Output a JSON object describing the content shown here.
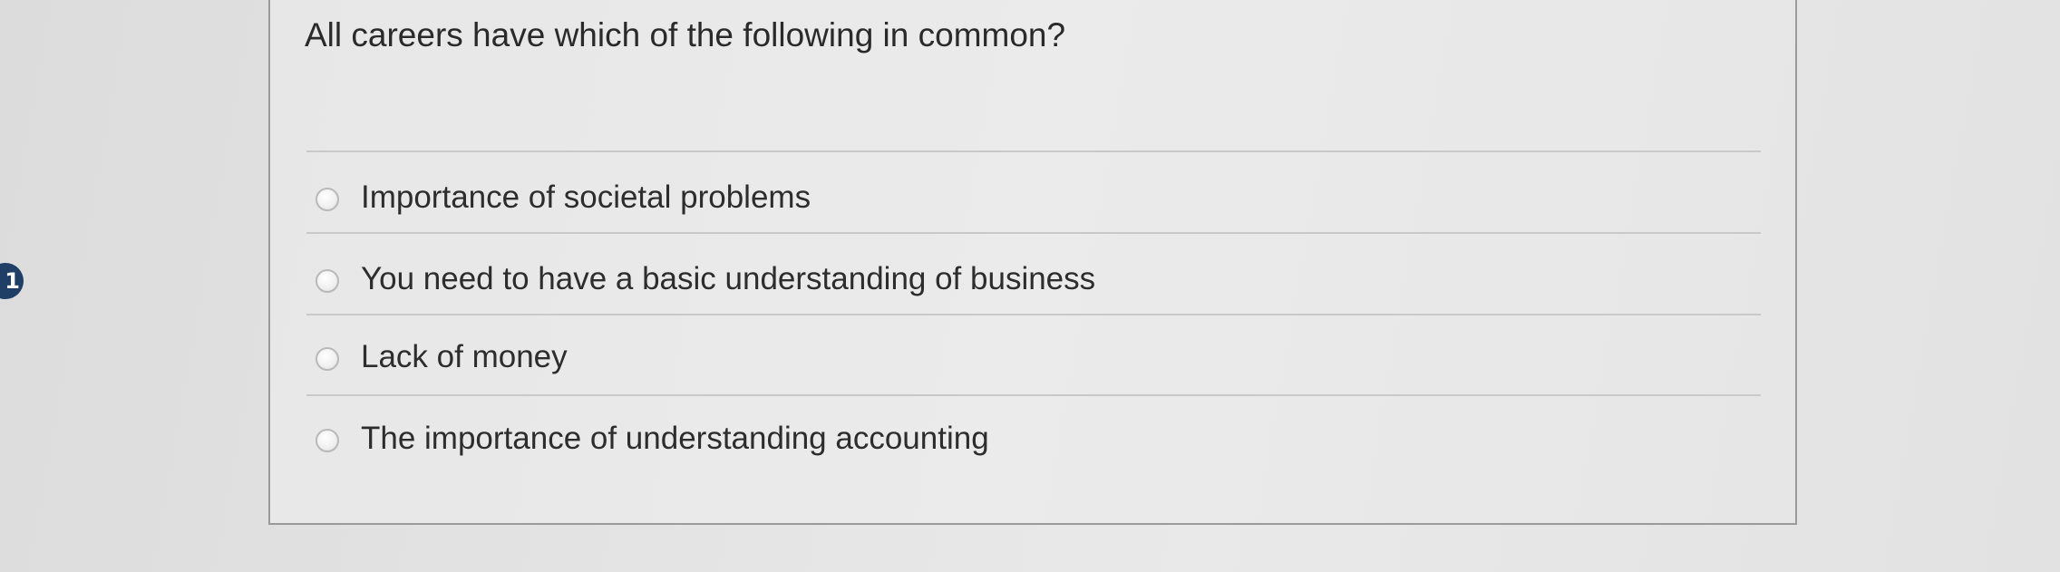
{
  "question": {
    "number": "1",
    "text": "All careers have which of the following in common?"
  },
  "options": [
    {
      "label": "Importance of societal problems",
      "selected": false
    },
    {
      "label": "You need to have a basic understanding of business",
      "selected": false
    },
    {
      "label": "Lack of money",
      "selected": false
    },
    {
      "label": "The importance of understanding accounting",
      "selected": false
    }
  ],
  "colors": {
    "badge": "#1f3f67",
    "border": "#9a9a9a",
    "divider": "#c9c9c9",
    "text": "#2a2a2a"
  }
}
